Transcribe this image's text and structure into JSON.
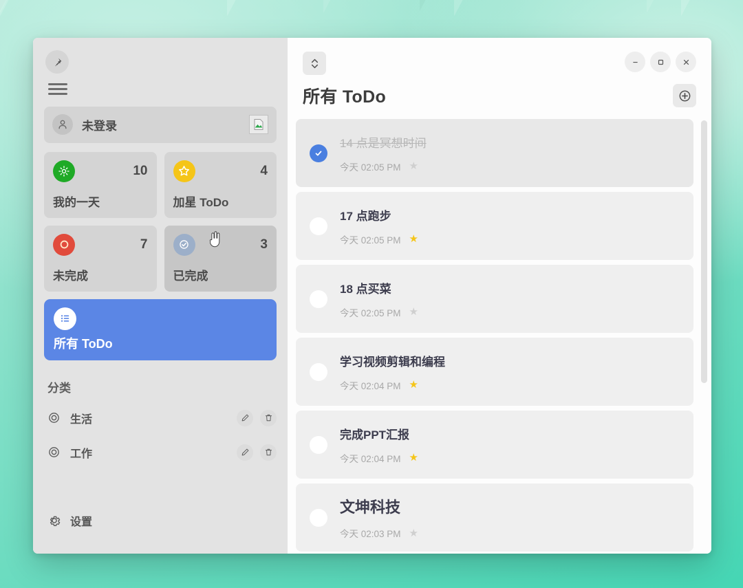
{
  "theme": {
    "accent": "#5b86e5",
    "background_top": "#a9e8d6",
    "background_bottom": "#45d6b4"
  },
  "sidebar": {
    "pin_icon": "pushpin-icon",
    "menu_icon": "hamburger-menu-icon",
    "user": {
      "name": "未登录",
      "avatar_icon": "person-icon",
      "image_icon": "broken-image-icon"
    },
    "stats": [
      {
        "label": "我的一天",
        "count": "10",
        "icon": "sun-icon",
        "color": "#1faa26",
        "hovered": false
      },
      {
        "label": "加星 ToDo",
        "count": "4",
        "icon": "star-icon",
        "color": "#f5c518",
        "hovered": false
      },
      {
        "label": "未完成",
        "count": "7",
        "icon": "circle-icon",
        "color": "#e14b3c",
        "hovered": false
      },
      {
        "label": "已完成",
        "count": "3",
        "icon": "check-circle-icon",
        "color": "#9cafc9",
        "hovered": true
      }
    ],
    "all_todo": {
      "label": "所有 ToDo",
      "icon": "list-icon",
      "selected": true
    },
    "categories_title": "分类",
    "categories": [
      {
        "name": "生活",
        "icon": "target-icon",
        "edit_icon": "pencil-icon",
        "delete_icon": "trash-icon"
      },
      {
        "name": "工作",
        "icon": "target-icon",
        "edit_icon": "pencil-icon",
        "delete_icon": "trash-icon"
      }
    ],
    "settings": {
      "label": "设置",
      "icon": "gear-icon"
    }
  },
  "main": {
    "collapse_icon": "chevron-up-down-icon",
    "window_controls": [
      {
        "name": "minimize",
        "icon": "minimize-icon"
      },
      {
        "name": "maximize",
        "icon": "maximize-icon"
      },
      {
        "name": "close",
        "icon": "close-icon"
      }
    ],
    "title": "所有 ToDo",
    "add_icon": "add-circle-icon",
    "todos": [
      {
        "text": "14 点是冥想时间",
        "time": "今天 02:05 PM",
        "done": true,
        "starred": false,
        "large": false
      },
      {
        "text": "17 点跑步",
        "time": "今天 02:05 PM",
        "done": false,
        "starred": true,
        "large": false
      },
      {
        "text": "18 点买菜",
        "time": "今天 02:05 PM",
        "done": false,
        "starred": false,
        "large": false
      },
      {
        "text": "学习视频剪辑和编程",
        "time": "今天 02:04 PM",
        "done": false,
        "starred": true,
        "large": false
      },
      {
        "text": "完成PPT汇报",
        "time": "今天 02:04 PM",
        "done": false,
        "starred": true,
        "large": false
      },
      {
        "text": "文坤科技",
        "time": "今天 02:03 PM",
        "done": false,
        "starred": false,
        "large": true
      }
    ]
  }
}
